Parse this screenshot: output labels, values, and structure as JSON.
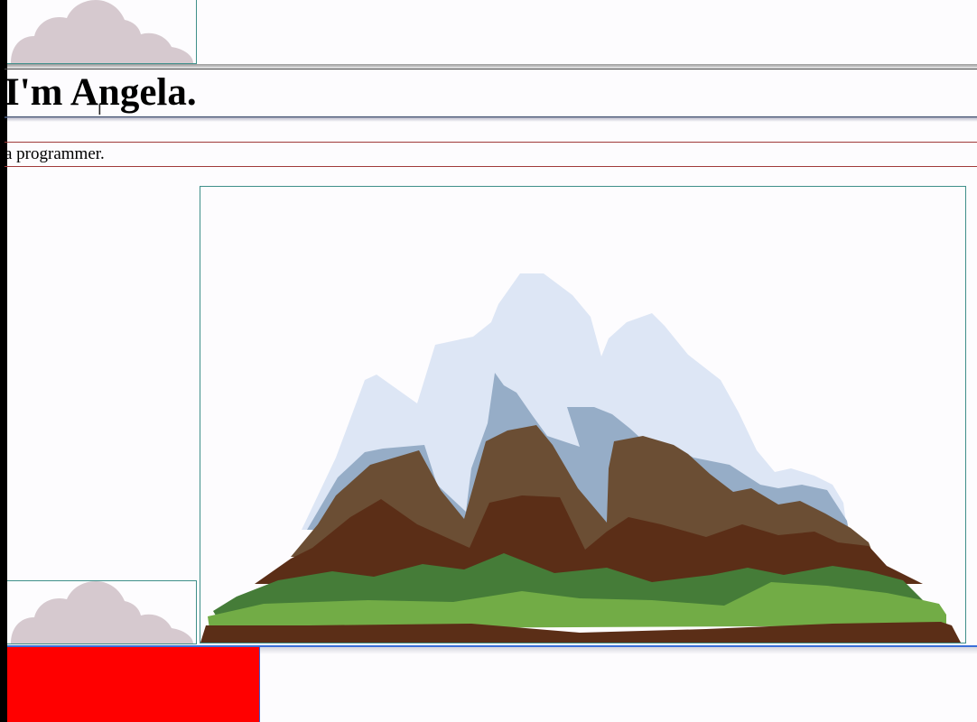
{
  "header": {
    "title": "I'm Angela.",
    "subtitle": "a programmer."
  },
  "images": {
    "cloud_top": "cloud-image",
    "cloud_bottom": "cloud-image",
    "mountain": "mountain-illustration"
  },
  "colors": {
    "cloud": "#d6c9cf",
    "box_border": "#3f8f8a",
    "red_box": "#ff0000",
    "snow": "#dde6f5",
    "snow_shadow": "#96adc7",
    "rock_light": "#6b4e34",
    "rock_dark": "#5b2e17",
    "grass_dark": "#457c38",
    "grass_light": "#72ac46"
  }
}
